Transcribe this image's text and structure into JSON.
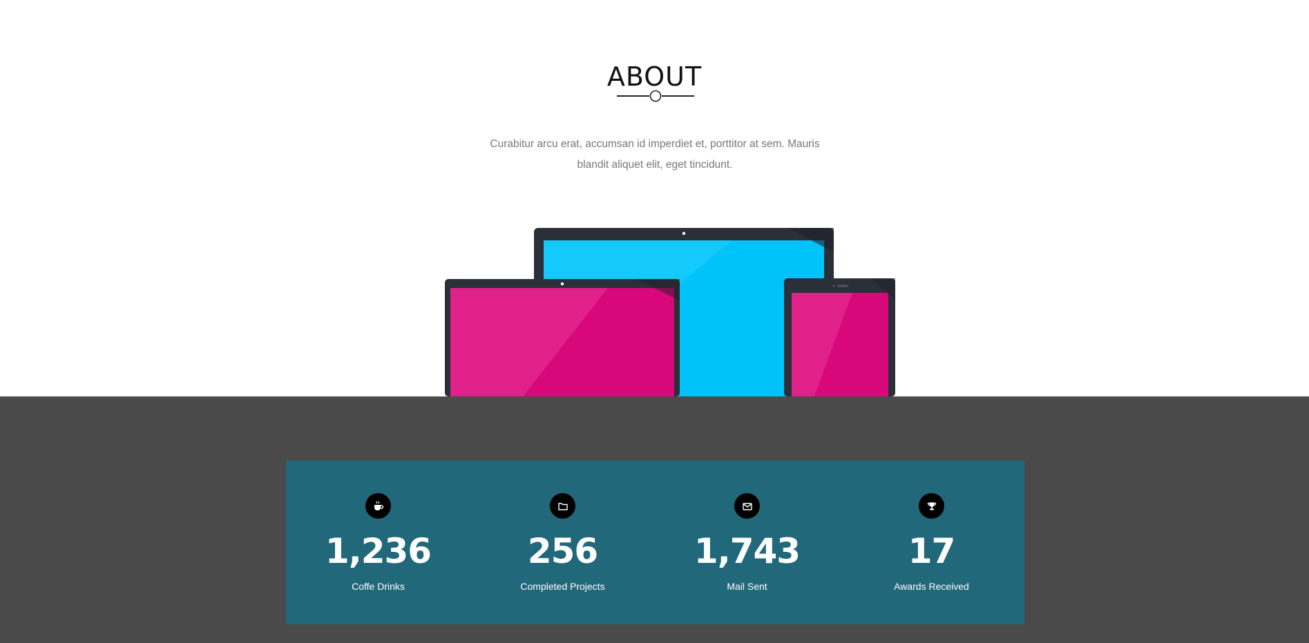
{
  "about": {
    "title": "ABOUT",
    "description": "Curabitur arcu erat, accumsan id imperdiet et, porttitor at sem. Mauris blandit aliquet elit, eget tincidunt."
  },
  "colors": {
    "stats_panel": "#22687b",
    "stats_background": "#4a4a4a",
    "screen_blue": "#00c3f9",
    "screen_pink": "#d8077a",
    "device_frame": "#2b2f38"
  },
  "stats": [
    {
      "icon": "coffee-icon",
      "value": "1,236",
      "label": "Coffe Drinks"
    },
    {
      "icon": "folder-icon",
      "value": "256",
      "label": "Completed Projects"
    },
    {
      "icon": "envelope-icon",
      "value": "1,743",
      "label": "Mail Sent"
    },
    {
      "icon": "trophy-icon",
      "value": "17",
      "label": "Awards Received"
    }
  ]
}
